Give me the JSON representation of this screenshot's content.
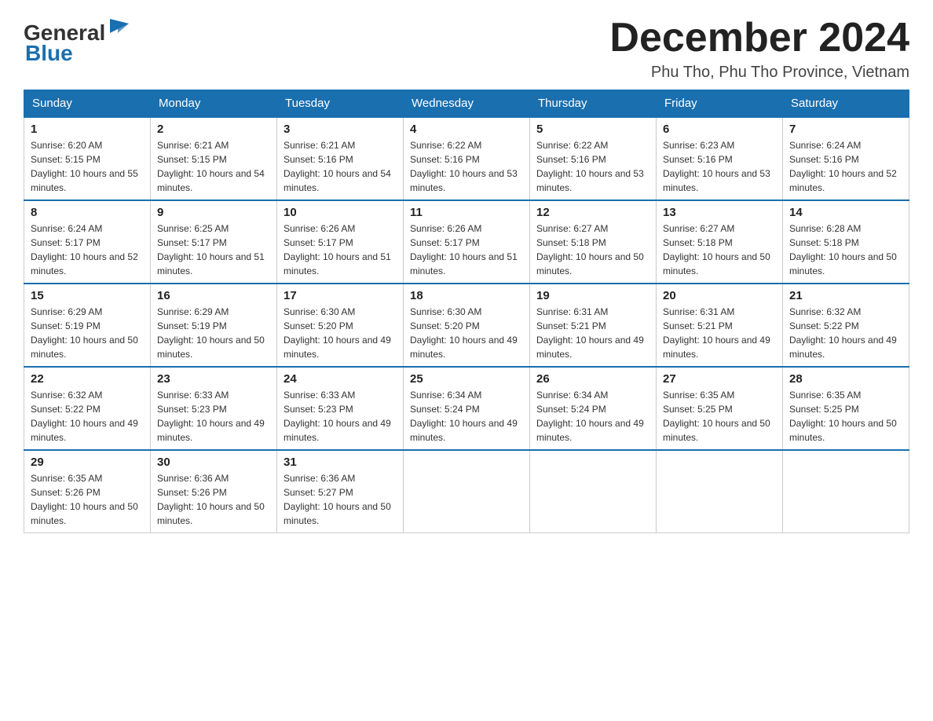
{
  "header": {
    "logo_general": "General",
    "logo_blue": "Blue",
    "month_title": "December 2024",
    "location": "Phu Tho, Phu Tho Province, Vietnam"
  },
  "days_of_week": [
    "Sunday",
    "Monday",
    "Tuesday",
    "Wednesday",
    "Thursday",
    "Friday",
    "Saturday"
  ],
  "weeks": [
    [
      {
        "day": "1",
        "sunrise": "6:20 AM",
        "sunset": "5:15 PM",
        "daylight": "10 hours and 55 minutes."
      },
      {
        "day": "2",
        "sunrise": "6:21 AM",
        "sunset": "5:15 PM",
        "daylight": "10 hours and 54 minutes."
      },
      {
        "day": "3",
        "sunrise": "6:21 AM",
        "sunset": "5:16 PM",
        "daylight": "10 hours and 54 minutes."
      },
      {
        "day": "4",
        "sunrise": "6:22 AM",
        "sunset": "5:16 PM",
        "daylight": "10 hours and 53 minutes."
      },
      {
        "day": "5",
        "sunrise": "6:22 AM",
        "sunset": "5:16 PM",
        "daylight": "10 hours and 53 minutes."
      },
      {
        "day": "6",
        "sunrise": "6:23 AM",
        "sunset": "5:16 PM",
        "daylight": "10 hours and 53 minutes."
      },
      {
        "day": "7",
        "sunrise": "6:24 AM",
        "sunset": "5:16 PM",
        "daylight": "10 hours and 52 minutes."
      }
    ],
    [
      {
        "day": "8",
        "sunrise": "6:24 AM",
        "sunset": "5:17 PM",
        "daylight": "10 hours and 52 minutes."
      },
      {
        "day": "9",
        "sunrise": "6:25 AM",
        "sunset": "5:17 PM",
        "daylight": "10 hours and 51 minutes."
      },
      {
        "day": "10",
        "sunrise": "6:26 AM",
        "sunset": "5:17 PM",
        "daylight": "10 hours and 51 minutes."
      },
      {
        "day": "11",
        "sunrise": "6:26 AM",
        "sunset": "5:17 PM",
        "daylight": "10 hours and 51 minutes."
      },
      {
        "day": "12",
        "sunrise": "6:27 AM",
        "sunset": "5:18 PM",
        "daylight": "10 hours and 50 minutes."
      },
      {
        "day": "13",
        "sunrise": "6:27 AM",
        "sunset": "5:18 PM",
        "daylight": "10 hours and 50 minutes."
      },
      {
        "day": "14",
        "sunrise": "6:28 AM",
        "sunset": "5:18 PM",
        "daylight": "10 hours and 50 minutes."
      }
    ],
    [
      {
        "day": "15",
        "sunrise": "6:29 AM",
        "sunset": "5:19 PM",
        "daylight": "10 hours and 50 minutes."
      },
      {
        "day": "16",
        "sunrise": "6:29 AM",
        "sunset": "5:19 PM",
        "daylight": "10 hours and 50 minutes."
      },
      {
        "day": "17",
        "sunrise": "6:30 AM",
        "sunset": "5:20 PM",
        "daylight": "10 hours and 49 minutes."
      },
      {
        "day": "18",
        "sunrise": "6:30 AM",
        "sunset": "5:20 PM",
        "daylight": "10 hours and 49 minutes."
      },
      {
        "day": "19",
        "sunrise": "6:31 AM",
        "sunset": "5:21 PM",
        "daylight": "10 hours and 49 minutes."
      },
      {
        "day": "20",
        "sunrise": "6:31 AM",
        "sunset": "5:21 PM",
        "daylight": "10 hours and 49 minutes."
      },
      {
        "day": "21",
        "sunrise": "6:32 AM",
        "sunset": "5:22 PM",
        "daylight": "10 hours and 49 minutes."
      }
    ],
    [
      {
        "day": "22",
        "sunrise": "6:32 AM",
        "sunset": "5:22 PM",
        "daylight": "10 hours and 49 minutes."
      },
      {
        "day": "23",
        "sunrise": "6:33 AM",
        "sunset": "5:23 PM",
        "daylight": "10 hours and 49 minutes."
      },
      {
        "day": "24",
        "sunrise": "6:33 AM",
        "sunset": "5:23 PM",
        "daylight": "10 hours and 49 minutes."
      },
      {
        "day": "25",
        "sunrise": "6:34 AM",
        "sunset": "5:24 PM",
        "daylight": "10 hours and 49 minutes."
      },
      {
        "day": "26",
        "sunrise": "6:34 AM",
        "sunset": "5:24 PM",
        "daylight": "10 hours and 49 minutes."
      },
      {
        "day": "27",
        "sunrise": "6:35 AM",
        "sunset": "5:25 PM",
        "daylight": "10 hours and 50 minutes."
      },
      {
        "day": "28",
        "sunrise": "6:35 AM",
        "sunset": "5:25 PM",
        "daylight": "10 hours and 50 minutes."
      }
    ],
    [
      {
        "day": "29",
        "sunrise": "6:35 AM",
        "sunset": "5:26 PM",
        "daylight": "10 hours and 50 minutes."
      },
      {
        "day": "30",
        "sunrise": "6:36 AM",
        "sunset": "5:26 PM",
        "daylight": "10 hours and 50 minutes."
      },
      {
        "day": "31",
        "sunrise": "6:36 AM",
        "sunset": "5:27 PM",
        "daylight": "10 hours and 50 minutes."
      },
      null,
      null,
      null,
      null
    ]
  ]
}
